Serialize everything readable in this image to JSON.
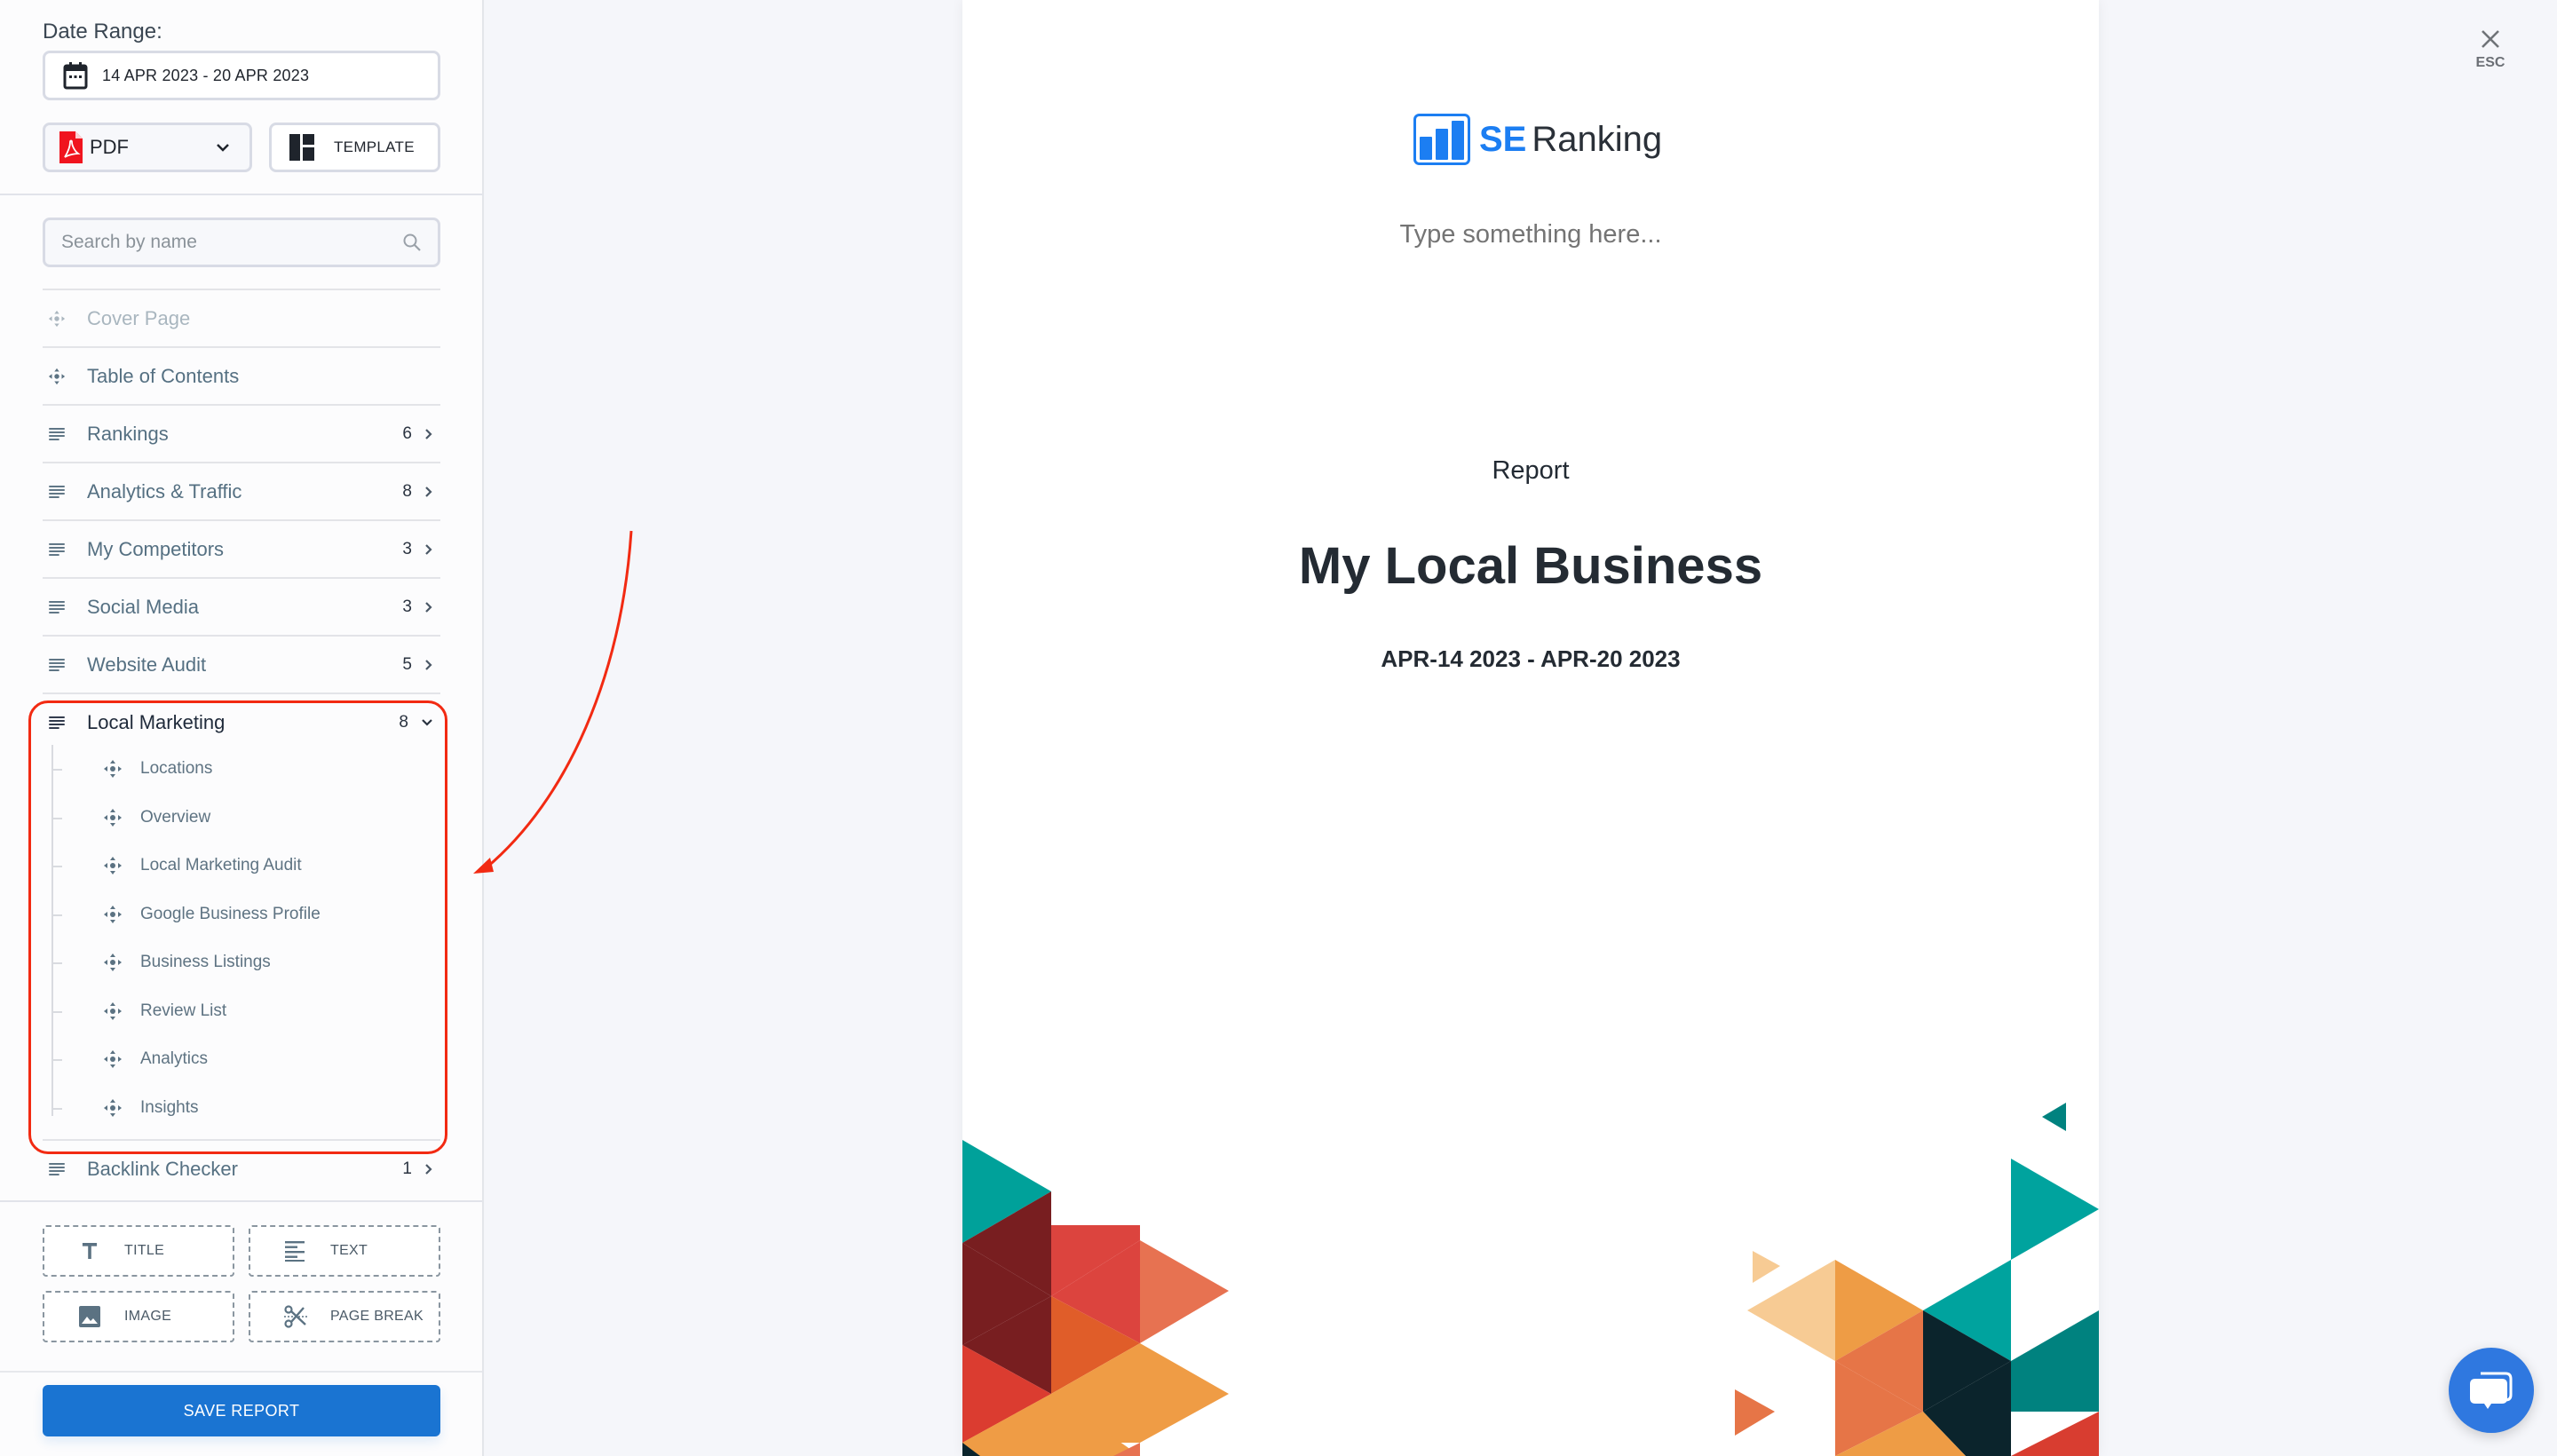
{
  "sidebar": {
    "date_range_label": "Date Range:",
    "date_range_value": "14 APR 2023 - 20 APR 2023",
    "format_select": {
      "value": "PDF",
      "icon": "pdf-file-icon"
    },
    "template_button": {
      "label": "TEMPLATE",
      "icon": "template-grid-icon"
    },
    "search": {
      "placeholder": "Search by name",
      "value": ""
    },
    "sections": [
      {
        "label": "Cover Page",
        "icon": "drag-move-icon",
        "disabled": true
      },
      {
        "label": "Table of Contents",
        "icon": "drag-move-icon"
      },
      {
        "label": "Rankings",
        "icon": "list-icon",
        "count": "6"
      },
      {
        "label": "Analytics & Traffic",
        "icon": "list-icon",
        "count": "8"
      },
      {
        "label": "My Competitors",
        "icon": "list-icon",
        "count": "3"
      },
      {
        "label": "Social Media",
        "icon": "list-icon",
        "count": "3"
      },
      {
        "label": "Website Audit",
        "icon": "list-icon",
        "count": "5"
      }
    ],
    "expanded_section": {
      "label": "Local Marketing",
      "count": "8",
      "items": [
        "Locations",
        "Overview",
        "Local Marketing Audit",
        "Google Business Profile",
        "Business Listings",
        "Review List",
        "Analytics",
        "Insights"
      ]
    },
    "after_sections": [
      {
        "label": "Backlink Checker",
        "icon": "list-icon",
        "count": "1"
      }
    ],
    "tools": [
      {
        "label": "TITLE",
        "icon": "title-t-icon"
      },
      {
        "label": "TEXT",
        "icon": "text-lines-icon"
      },
      {
        "label": "IMAGE",
        "icon": "image-icon"
      },
      {
        "label": "PAGE BREAK",
        "icon": "scissors-icon"
      }
    ],
    "save_button": "SAVE REPORT"
  },
  "preview": {
    "logo": {
      "se": "SE",
      "ranking": "Ranking"
    },
    "placeholder_text": "Type something here...",
    "report_label": "Report",
    "title": "My Local Business",
    "dates": "APR-14 2023 - APR-20 2023"
  },
  "close": {
    "label": "ESC",
    "icon": "close-x-icon"
  },
  "chat": {
    "icon": "chat-bubbles-icon"
  },
  "colors": {
    "accent": "#1a74d2",
    "logo_blue": "#1c7ef2",
    "highlight": "#f22a12",
    "chat": "#2f78e0"
  }
}
